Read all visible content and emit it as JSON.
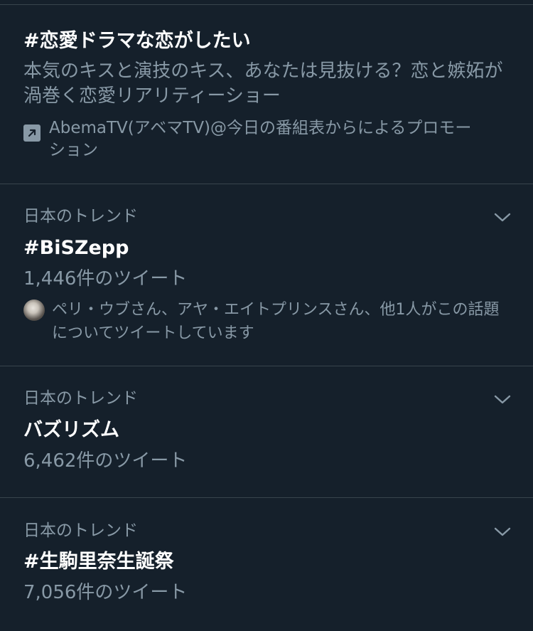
{
  "promoted": {
    "title": "#恋愛ドラマな恋がしたい",
    "description": "本気のキスと演技のキス、あなたは見抜ける？恋と嫉妬が渦巻く恋愛リアリティーショー",
    "promoted_by": "AbemaTV(アベマTV)@今日の番組表からによるプロモーション",
    "icon": "promoted-arrow-icon"
  },
  "trends": [
    {
      "label": "日本のトレンド",
      "title": "#BiSZepp",
      "count": "1,446件のツイート",
      "context": "ペリ・ウブさん、アヤ・エイトプリンスさん、他1人がこの話題についてツイートしています"
    },
    {
      "label": "日本のトレンド",
      "title": "バズリズム",
      "count": "6,462件のツイート"
    },
    {
      "label": "日本のトレンド",
      "title": "#生駒里奈生誕祭",
      "count": "7,056件のツイート"
    }
  ],
  "colors": {
    "background": "#15202b",
    "text_primary": "#ffffff",
    "text_secondary": "#8899a6",
    "divider": "#38444d"
  }
}
